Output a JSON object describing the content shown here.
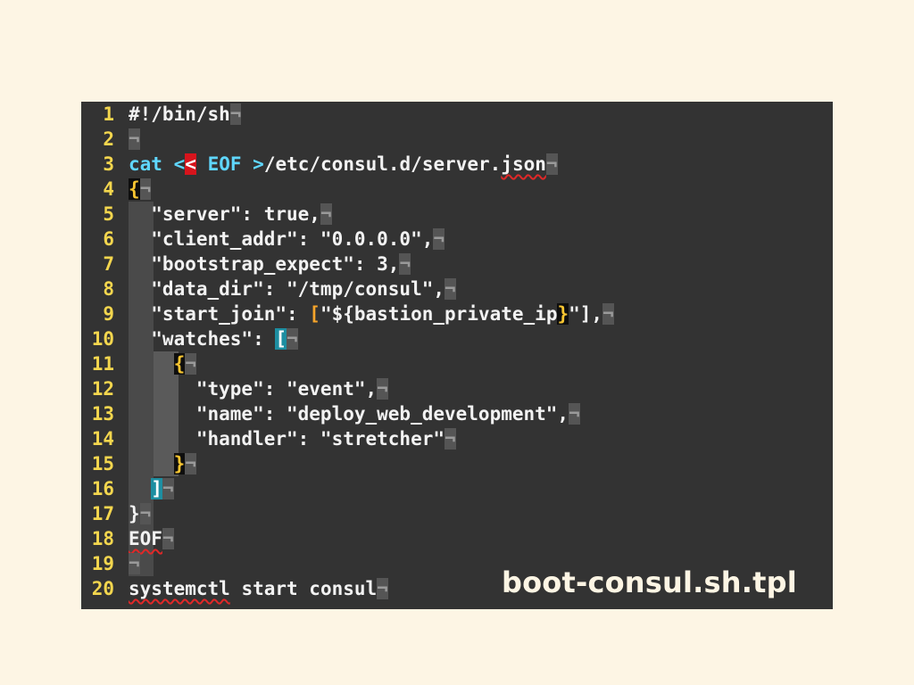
{
  "editor": {
    "lines": [
      {
        "n": "1",
        "segs": [
          {
            "t": "#!/bin/sh"
          }
        ]
      },
      {
        "n": "2",
        "segs": []
      },
      {
        "n": "3",
        "segs": [
          {
            "t": "cat",
            "c": "kw"
          },
          {
            "t": " "
          },
          {
            "t": "<",
            "c": "kw"
          },
          {
            "t": "<",
            "c": "hl-red"
          },
          {
            "t": " "
          },
          {
            "t": "EOF",
            "c": "kw"
          },
          {
            "t": " "
          },
          {
            "t": ">",
            "c": "kw"
          },
          {
            "t": "/etc/consul.d/server."
          },
          {
            "t": "json",
            "c": "squiggle"
          }
        ]
      },
      {
        "n": "4",
        "segs": [
          {
            "t": "{",
            "c": "hl-black"
          }
        ]
      },
      {
        "n": "5",
        "segs": [
          {
            "t": "  \"server\": true,"
          }
        ]
      },
      {
        "n": "6",
        "segs": [
          {
            "t": "  \"client_addr\": \"0.0.0.0\","
          }
        ]
      },
      {
        "n": "7",
        "segs": [
          {
            "t": "  \"bootstrap_expect\": 3,"
          }
        ]
      },
      {
        "n": "8",
        "segs": [
          {
            "t": "  \"data_dir\": \"/tmp/consul\","
          }
        ]
      },
      {
        "n": "9",
        "segs": [
          {
            "t": "  \"start_join\": "
          },
          {
            "t": "[",
            "c": "brace-orange"
          },
          {
            "t": "\"${bastion_private_ip"
          },
          {
            "t": "}",
            "c": "hl-black"
          },
          {
            "t": "\"],"
          }
        ]
      },
      {
        "n": "10",
        "segs": [
          {
            "t": "  \"watches\": "
          },
          {
            "t": "[",
            "c": "hl-cyan"
          }
        ]
      },
      {
        "n": "11",
        "segs": [
          {
            "t": "    "
          },
          {
            "t": "{",
            "c": "hl-black"
          }
        ]
      },
      {
        "n": "12",
        "segs": [
          {
            "t": "      \"type\": \"event\","
          }
        ]
      },
      {
        "n": "13",
        "segs": [
          {
            "t": "      \"name\": \"deploy_web_development\","
          }
        ]
      },
      {
        "n": "14",
        "segs": [
          {
            "t": "      \"handler\": \"stretcher\""
          }
        ]
      },
      {
        "n": "15",
        "segs": [
          {
            "t": "    "
          },
          {
            "t": "}",
            "c": "hl-black"
          }
        ]
      },
      {
        "n": "16",
        "segs": [
          {
            "t": "  "
          },
          {
            "t": "]",
            "c": "hl-cyan"
          }
        ]
      },
      {
        "n": "17",
        "segs": [
          {
            "t": "}"
          }
        ]
      },
      {
        "n": "18",
        "segs": [
          {
            "t": "EOF",
            "c": "squiggle"
          }
        ]
      },
      {
        "n": "19",
        "segs": []
      },
      {
        "n": "20",
        "segs": [
          {
            "t": "systemctl",
            "c": "squiggle"
          },
          {
            "t": " start consul"
          }
        ]
      }
    ],
    "eol_marker": "¬"
  },
  "caption": "boot-consul.sh.tpl",
  "colors": {
    "page_background": "#fdf5e4",
    "editor_background": "#333333",
    "line_number": "#f3d64e",
    "keyword": "#5fd7ff",
    "error_squiggle": "#e02828"
  }
}
